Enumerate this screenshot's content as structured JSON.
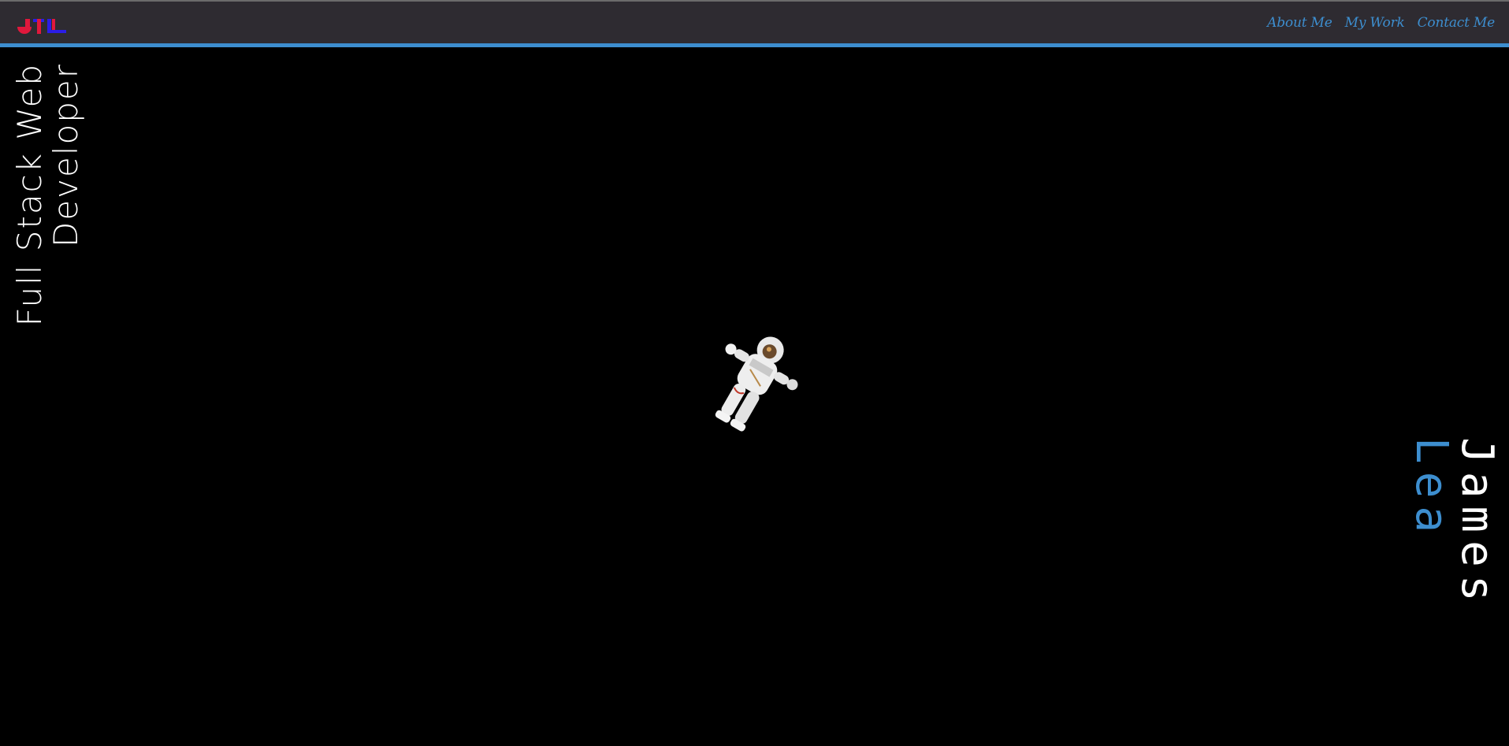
{
  "header": {
    "logo_text": "JTL",
    "nav": [
      {
        "label": "About Me"
      },
      {
        "label": "My Work"
      },
      {
        "label": "Contact Me"
      }
    ]
  },
  "hero": {
    "tagline": "Full Stack Web Developer",
    "name_first": "James",
    "name_last": "Lea"
  },
  "colors": {
    "accent": "#3d8ecf",
    "header_bg": "#2e2b31",
    "background": "#000000",
    "text": "#ffffff"
  }
}
